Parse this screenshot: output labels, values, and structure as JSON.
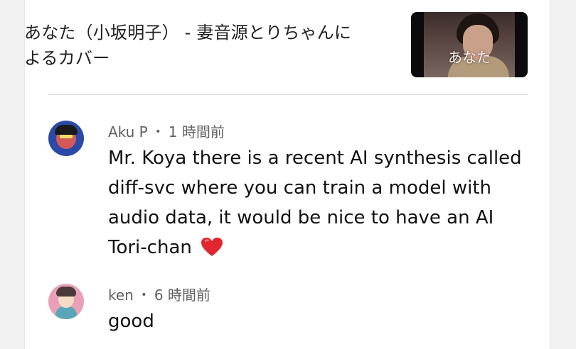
{
  "video": {
    "title": "あなた（小坂明子） - 妻音源とりちゃんによるカバー",
    "thumbnail_text": "あなた"
  },
  "comments": [
    {
      "author": "Aku P",
      "separator": "•",
      "time": "1 時間前",
      "text": "Mr. Koya there is a recent AI synthesis called diff-svc where you can train a model with audio data, it would be nice to have an AI Tori-chan",
      "emoji": "red-heart-icon"
    },
    {
      "author": "ken",
      "separator": "•",
      "time": "6 時間前",
      "text": "good"
    }
  ],
  "colors": {
    "heart": "#e0262f",
    "meta_text": "#606060",
    "body_text": "#111111"
  }
}
